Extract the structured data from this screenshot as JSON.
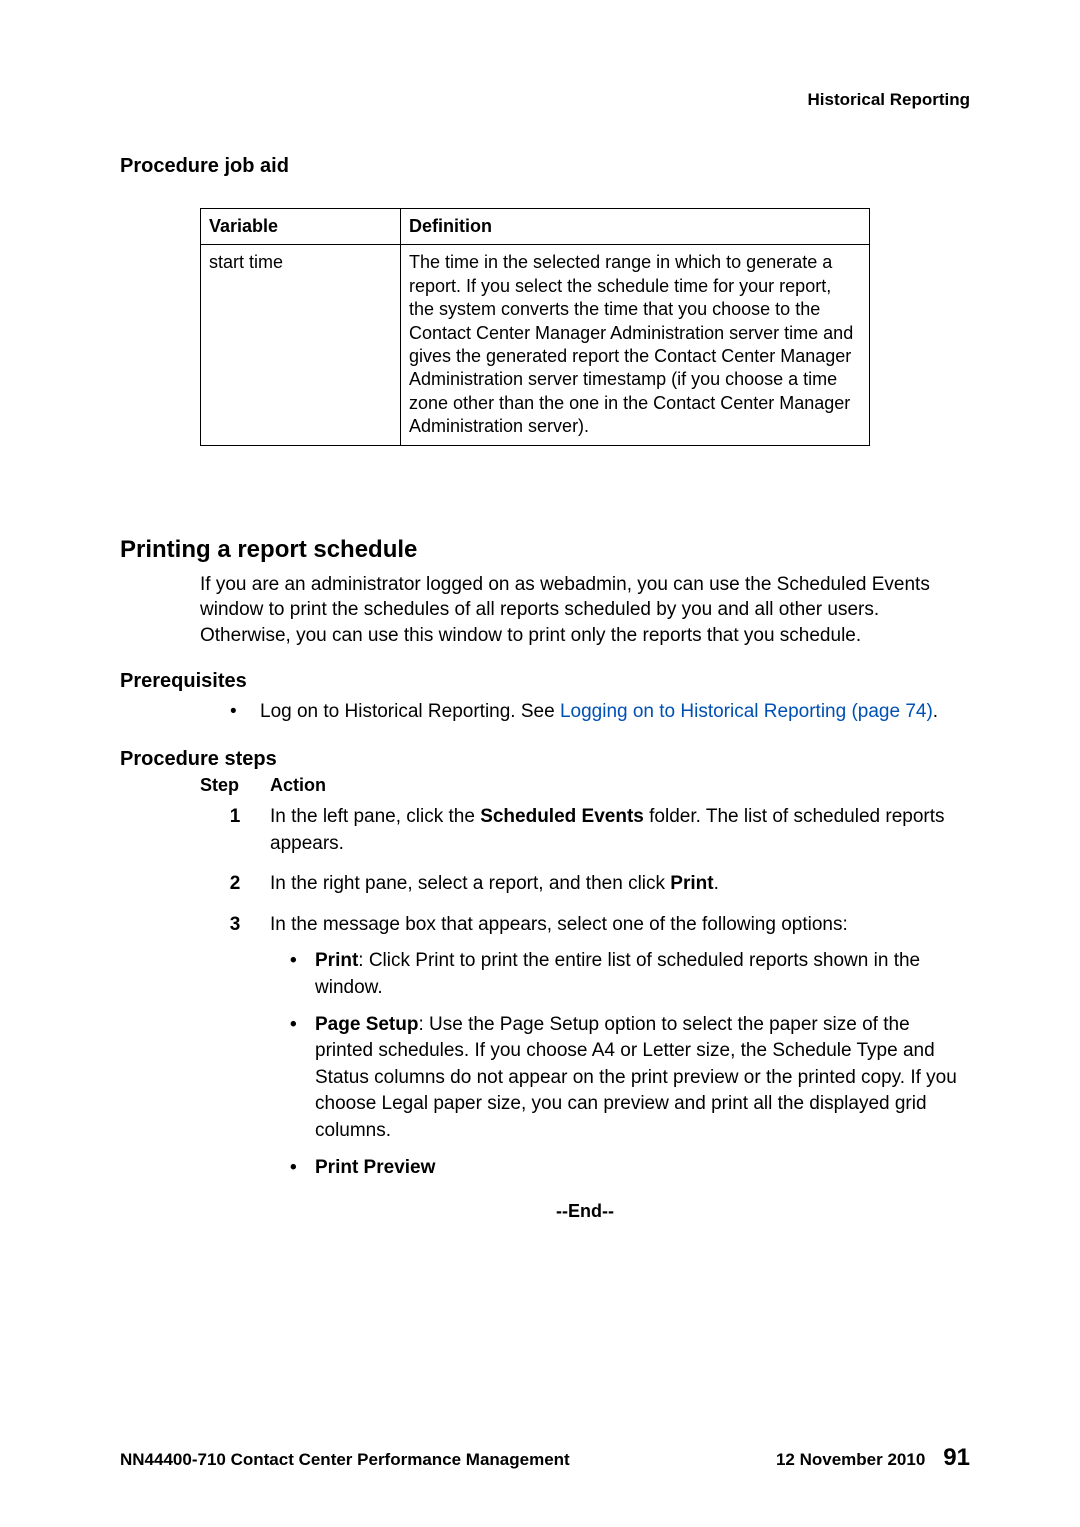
{
  "header": {
    "category": "Historical Reporting"
  },
  "jobaid": {
    "heading": "Procedure job aid",
    "table": {
      "head_variable": "Variable",
      "head_definition": "Definition",
      "row1_variable": "start time",
      "row1_definition": "The time in the selected range in which to generate a report. If you select the schedule time for your report, the system converts the time that you choose to the Contact Center Manager Administration server time and gives the generated report the Contact Center Manager Administration server timestamp (if you choose a time zone other than the one in the Contact Center Manager Administration server)."
    }
  },
  "section": {
    "title": "Printing a report schedule",
    "intro": "If you are an administrator logged on as webadmin, you can use the Scheduled Events window to print the schedules of all reports scheduled by you and all other users. Otherwise, you can use this window to print only the reports that you schedule.",
    "prereq_heading": "Prerequisites",
    "prereq_text": "Log on to Historical Reporting. See ",
    "prereq_link": "Logging on to Historical Reporting (page 74)",
    "prereq_period": ".",
    "steps_heading": "Procedure steps",
    "step_label": "Step",
    "action_label": "Action",
    "steps": {
      "s1_num": "1",
      "s1_a": "In the left pane, click the ",
      "s1_bold": "Scheduled Events",
      "s1_b": " folder. The list of scheduled reports appears.",
      "s2_num": "2",
      "s2_a": "In the right pane, select a report, and then click ",
      "s2_bold": "Print",
      "s2_b": ".",
      "s3_num": "3",
      "s3_text": "In the message box that appears, select one of the following options:",
      "s3_b1_bold": "Print",
      "s3_b1_text": ": Click Print to print the entire list of scheduled reports shown in the window.",
      "s3_b2_bold": "Page Setup",
      "s3_b2_text": ": Use the Page Setup option to select the paper size of the printed schedules. If you choose A4 or Letter size, the Schedule Type and Status columns do not appear on the print preview or the printed copy. If you choose Legal paper size, you can preview and print all the displayed grid columns.",
      "s3_b3_bold": "Print Preview"
    },
    "end": "--End--"
  },
  "footer": {
    "doc": "NN44400-710 Contact Center Performance Management",
    "date": "12 November 2010",
    "page": "91"
  }
}
